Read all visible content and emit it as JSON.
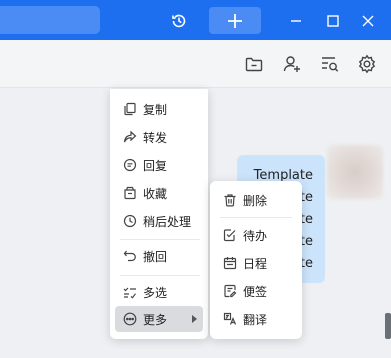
{
  "colors": {
    "titlebar": "#1e6ff0",
    "bubble": "#cce4fb",
    "menu_active": "#d9dbdf"
  },
  "titlebar": {
    "icons": [
      "history-icon",
      "plus-icon",
      "minimize-icon",
      "maximize-icon",
      "close-icon"
    ]
  },
  "toolbar": {
    "icons": [
      "folder-icon",
      "add-contact-icon",
      "search-history-icon",
      "gear-icon"
    ]
  },
  "message": {
    "lines": [
      "Template",
      "late",
      "late",
      "late",
      "late"
    ]
  },
  "context_menu": {
    "items": [
      {
        "label": "复制",
        "icon": "copy-icon"
      },
      {
        "label": "转发",
        "icon": "forward-icon"
      },
      {
        "label": "回复",
        "icon": "reply-icon"
      },
      {
        "label": "收藏",
        "icon": "favorite-icon"
      },
      {
        "label": "稍后处理",
        "icon": "clock-icon"
      },
      {
        "label": "撤回",
        "icon": "undo-icon"
      },
      {
        "label": "多选",
        "icon": "multi-select-icon"
      },
      {
        "label": "更多",
        "icon": "more-icon"
      }
    ]
  },
  "submenu": {
    "items": [
      {
        "label": "删除",
        "icon": "trash-icon"
      },
      {
        "label": "待办",
        "icon": "todo-icon"
      },
      {
        "label": "日程",
        "icon": "calendar-icon"
      },
      {
        "label": "便签",
        "icon": "note-icon"
      },
      {
        "label": "翻译",
        "icon": "translate-icon"
      }
    ]
  }
}
